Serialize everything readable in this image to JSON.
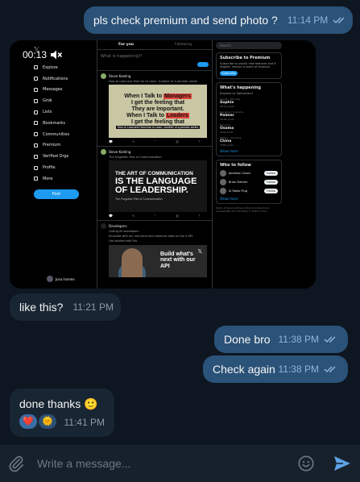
{
  "messages": [
    {
      "text": "pls check premium and send photo ?",
      "time": "11:14 PM"
    },
    {
      "text": "like this?",
      "time": "11:21 PM"
    },
    {
      "text": "Done bro",
      "time": "11:38 PM"
    },
    {
      "text": "Check again",
      "time": "11:38 PM"
    },
    {
      "text": "done thanks 🙂",
      "time": "11:41 PM"
    }
  ],
  "video": {
    "duration": "00:13",
    "x_nav": [
      "Explore",
      "Notifications",
      "Messages",
      "Grok",
      "Lists",
      "Bookmarks",
      "Communities",
      "Premium",
      "Verified Orgs",
      "Profile",
      "More"
    ],
    "x_post_button": "Post",
    "x_profile_name": "Josa Isomes",
    "x_tabs": [
      "For you",
      "Following"
    ],
    "x_compose_placeholder": "What is happening?!",
    "tweet1_author": "Steve Keeling",
    "tweet1_text": "How to Lead and Heal for to Lead - Another of a periodic series",
    "meme_lines": [
      "When I Talk to",
      "Managers",
      "I get the feeling that",
      "They are Important.",
      "When I Talk to",
      "Leaders",
      "I get the feeling that"
    ],
    "meme_caption": "How to Lead and Heal how to Lead - Another of a periodic series",
    "tweet2_author": "Steve Keeling",
    "tweet2_text": "The Forgotten Part of Communication",
    "leader_lines": [
      "THE ART OF COMMUNICATION",
      "IS THE LANGUAGE",
      "OF LEADERSHIP.",
      "The Forgotten Part of Communication"
    ],
    "tweet3_author": "Developers",
    "tweet3_text": "Calling all developers",
    "tweet3_body": "Innovate with our real-time and historical data on the X API.",
    "tweet3_cta": "Get started with Pro",
    "api_ad_text": "Build what's next with our API",
    "x_search_placeholder": "Search",
    "premium_title": "Subscribe to Premium",
    "premium_text": "Subscribe to unlock new features and if eligible, receive a share of revenue.",
    "premium_button": "Subscribe",
    "happening_title": "What's happening",
    "happening_event": "England vs Switzerland",
    "trends": [
      {
        "ctx": "Sports · Trending",
        "name": "Sophia",
        "count": "38.1K posts"
      },
      {
        "ctx": "Trending in Canada",
        "name": "Palmer",
        "count": "18.8K posts"
      },
      {
        "ctx": "Trending",
        "name": "Osama",
        "count": "109K posts"
      },
      {
        "ctx": "Politics · Trending",
        "name": "China",
        "count": "336K posts"
      }
    ],
    "show_more": "Show more",
    "who_to_follow_title": "Who to follow",
    "who_to_follow": [
      "Jonathan Chadi",
      "Brian Stecher",
      "Al Radio Plug"
    ],
    "follow_label": "Follow",
    "footer_links": "Terms of Service  Privacy Policy  Cookie Policy  Accessibility  Ads info  More  © 2024 X Corp."
  },
  "reactions": [
    "❤️",
    "🌞"
  ],
  "composer": {
    "placeholder": "Write a message..."
  },
  "colors": {
    "background": "#0e1621",
    "outgoing": "#2b5278",
    "incoming": "#182533",
    "accent": "#5ea0e6"
  }
}
